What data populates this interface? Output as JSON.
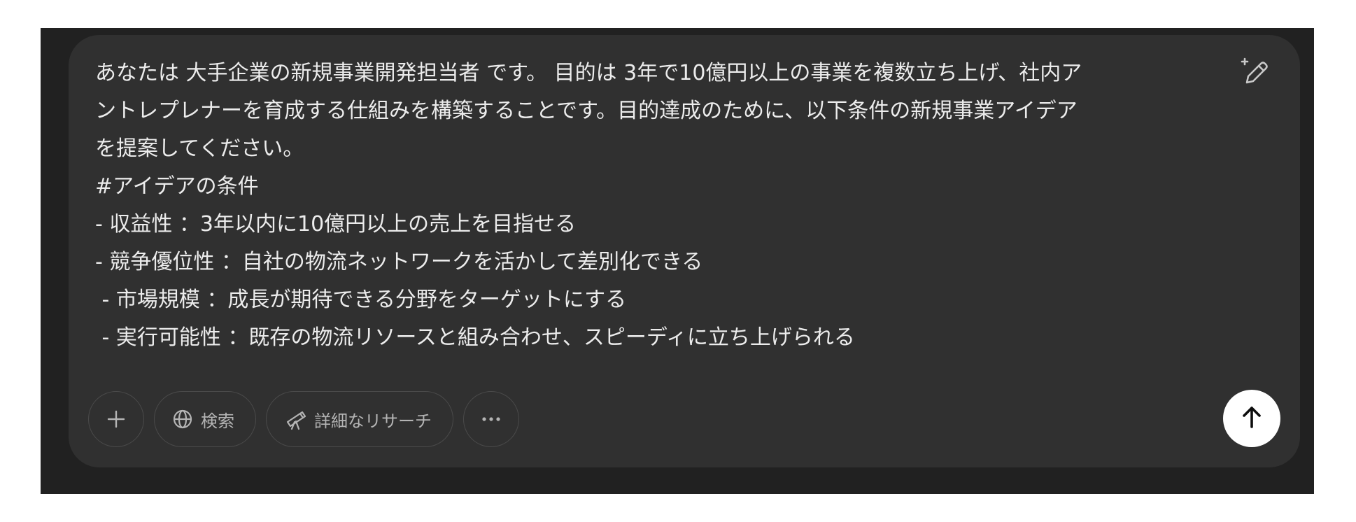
{
  "composer": {
    "prompt_lines": [
      "あなたは 大手企業の新規事業開発担当者 です。 目的は 3年で10億円以上の事業を複数立ち上げ、社内ア",
      "ントレプレナーを育成する仕組みを構築することです。目的達成のために、以下条件の新規事業アイデア",
      "を提案してください。",
      "#アイデアの条件",
      "- 収益性 ：3年以内に10億円以上の売上を目指せる",
      "- 競争優位性 ：自社の物流ネットワークを活かして差別化できる",
      " - 市場規模 ：成長が期待できる分野をターゲットにする",
      " - 実行可能性 ：既存の物流リソースと組み合わせ、スピーディに立ち上げられる"
    ]
  },
  "toolbar": {
    "add_icon": "plus-icon",
    "search_label": "検索",
    "search_icon": "globe-icon",
    "research_label": "詳細なリサーチ",
    "research_icon": "telescope-icon",
    "more_icon": "ellipsis-icon"
  },
  "send": {
    "icon": "arrow-up-icon"
  },
  "colors": {
    "outer_bg": "#212121",
    "composer_bg": "#303030",
    "text": "#ececec",
    "muted": "#b4b4b4",
    "send_bg": "#ffffff"
  }
}
